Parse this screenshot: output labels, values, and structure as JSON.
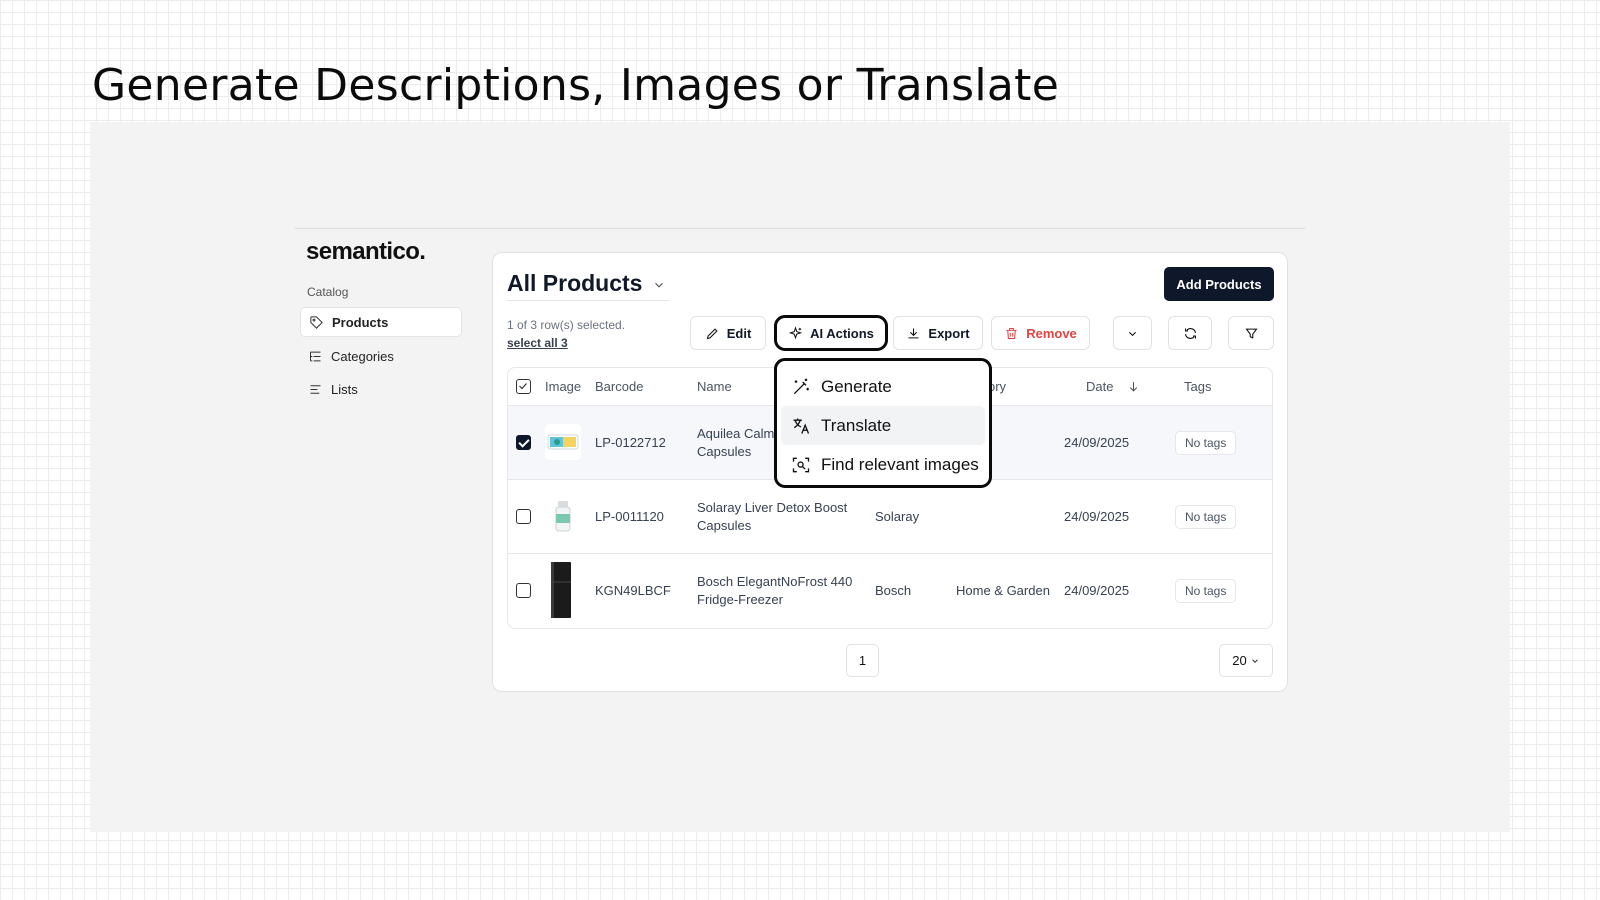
{
  "headline": "Generate Descriptions, Images or Translate",
  "brand": "semantico.",
  "sidebar": {
    "section": "Catalog",
    "items": [
      {
        "label": "Products",
        "icon": "tag-icon",
        "active": true
      },
      {
        "label": "Categories",
        "icon": "list-tree-icon",
        "active": false
      },
      {
        "label": "Lists",
        "icon": "list-icon",
        "active": false
      }
    ]
  },
  "main": {
    "title": "All Products",
    "add_button": "Add Products",
    "selection_text": "1 of 3 row(s) selected.",
    "select_all": "select all 3"
  },
  "toolbar": {
    "edit": "Edit",
    "ai_actions": "AI Actions",
    "export": "Export",
    "remove": "Remove"
  },
  "ai_menu": {
    "items": [
      "Generate",
      "Translate",
      "Find relevant images"
    ]
  },
  "table": {
    "headers": {
      "image": "Image",
      "barcode": "Barcode",
      "name": "Name",
      "category_partial": "ory",
      "date": "Date",
      "tags": "Tags"
    },
    "rows": [
      {
        "selected": true,
        "barcode": "LP-0122712",
        "name_line1": "Aquilea Calm",
        "name_line2": "Capsules",
        "brand": "",
        "category": "",
        "date": "24/09/2025",
        "tags": "No tags"
      },
      {
        "selected": false,
        "barcode": "LP-0011120",
        "name_line1": "Solaray Liver Detox Boost",
        "name_line2": "Capsules",
        "brand": "Solaray",
        "category": "",
        "date": "24/09/2025",
        "tags": "No tags"
      },
      {
        "selected": false,
        "barcode": "KGN49LBCF",
        "name_line1": "Bosch ElegantNoFrost 440",
        "name_line2": "Fridge-Freezer",
        "brand": "Bosch",
        "category": "Home & Garden",
        "date": "24/09/2025",
        "tags": "No tags"
      }
    ]
  },
  "pagination": {
    "current_page": "1",
    "per_page": "20"
  },
  "colors": {
    "primary": "#0f172a",
    "danger": "#e24444",
    "highlight_border": "#0a0a0a"
  }
}
